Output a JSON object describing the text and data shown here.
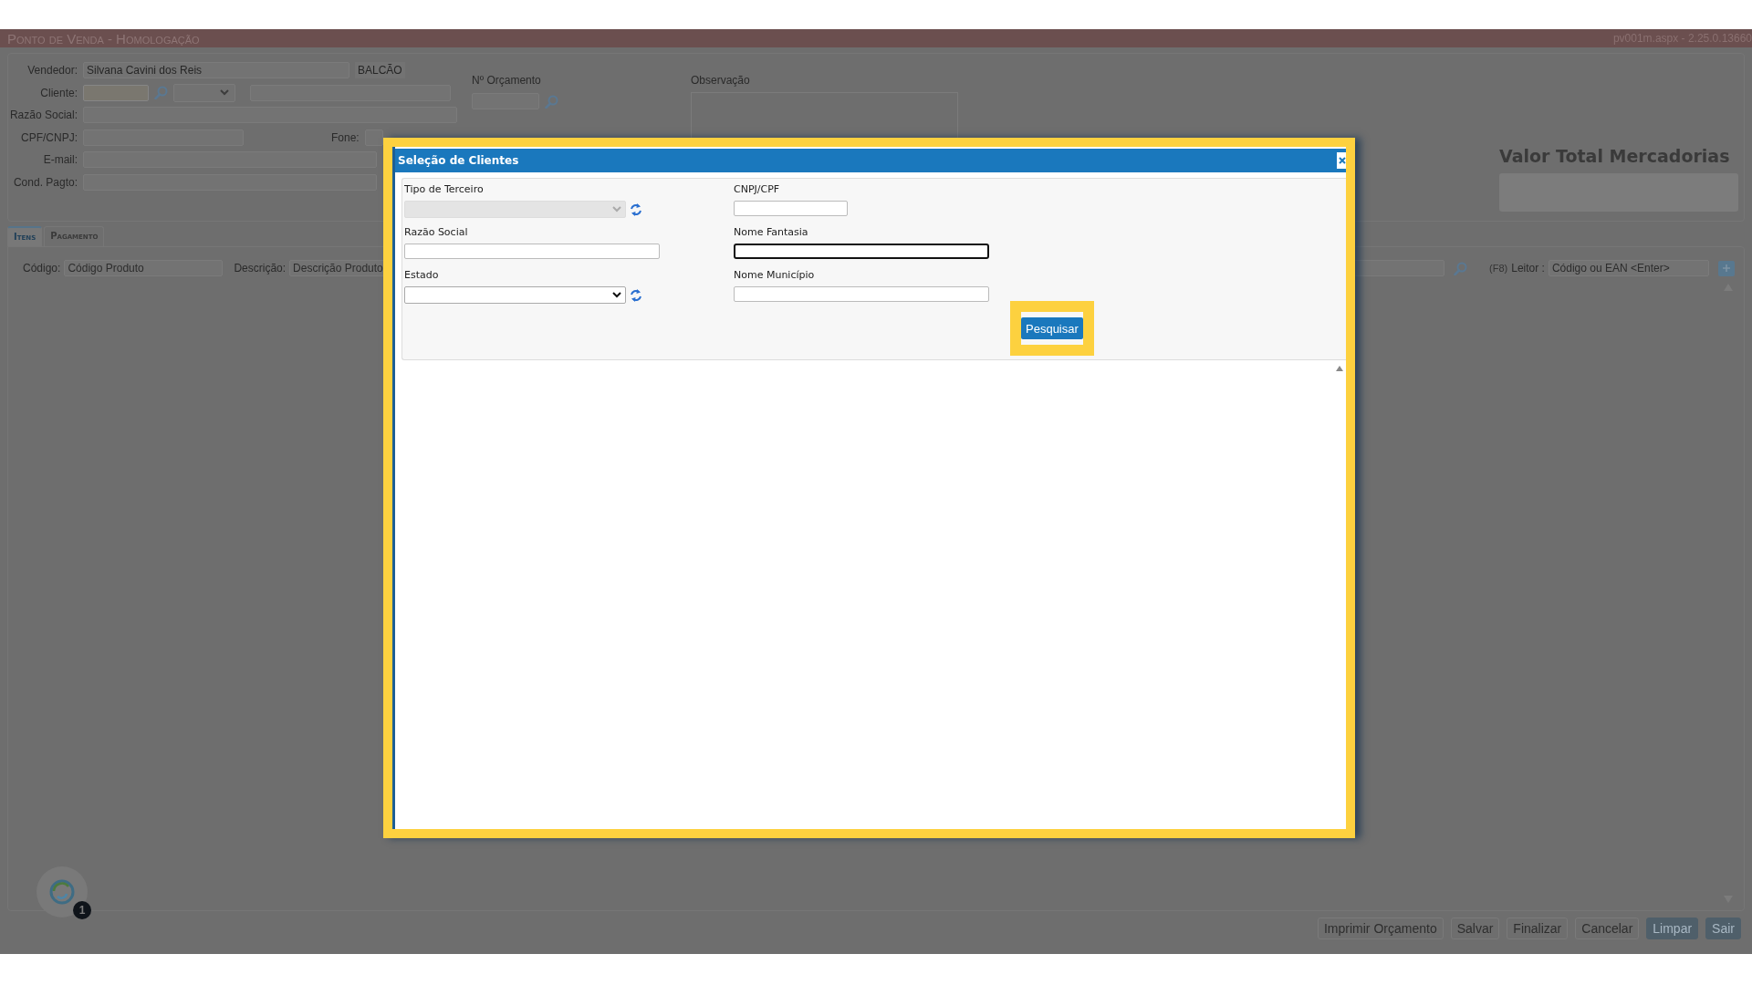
{
  "app_header": {
    "title": "Ponto de Venda - Homologação",
    "version": "pv001m.aspx - 2.25.0.13660"
  },
  "form": {
    "vendedor": {
      "label": "Vendedor:",
      "value": "Silvana Cavini dos Reis",
      "tag": "BALCÃO"
    },
    "cliente_label": "Cliente:",
    "razao_social_label": "Razão Social:",
    "cpf_label": "CPF/CNPJ:",
    "fone_label": "Fone:",
    "email_label": "E-mail:",
    "cond_pagto_label": "Cond. Pagto:",
    "orcamento_label": "Nº Orçamento",
    "observacao_label": "Observação"
  },
  "totals": {
    "title": "Valor Total Mercadorias"
  },
  "tabs": [
    {
      "label": "Itens",
      "selected": true
    },
    {
      "label": "Pagamento",
      "selected": false
    }
  ],
  "items_search": {
    "codigo_label": "Código:",
    "codigo_placeholder": "Código Produto",
    "descricao_label": "Descrição:",
    "descricao_placeholder": "Descrição Produto",
    "leitor_hint": "(F8)",
    "leitor_label": "Leitor :",
    "leitor_placeholder": "Código ou EAN <Enter>"
  },
  "footer_buttons": [
    {
      "label": "Imprimir Orçamento",
      "kind": "outline"
    },
    {
      "label": "Salvar",
      "kind": "outline"
    },
    {
      "label": "Finalizar",
      "kind": "outline"
    },
    {
      "label": "Cancelar",
      "kind": "outline"
    },
    {
      "label": "Limpar",
      "kind": "primary"
    },
    {
      "label": "Sair",
      "kind": "primary"
    }
  ],
  "assistant": {
    "badge": "1"
  },
  "dialog": {
    "title": "Seleção de Clientes",
    "highlighted": true,
    "fields": [
      {
        "label": "Tipo de Terceiro",
        "kind": "select",
        "disabled": true,
        "focused": false
      },
      {
        "label": "CNPJ/CPF",
        "kind": "input",
        "disabled": false,
        "focused": false
      },
      {
        "label": "Razão Social",
        "kind": "input",
        "disabled": false,
        "focused": false
      },
      {
        "label": "Nome Fantasia",
        "kind": "input",
        "disabled": false,
        "focused": true
      },
      {
        "label": "Estado",
        "kind": "select",
        "disabled": false,
        "focused": false
      },
      {
        "label": "Nome Município",
        "kind": "input",
        "disabled": false,
        "focused": false
      }
    ],
    "search_button": {
      "label": "Pesquisar",
      "highlighted": true
    }
  }
}
